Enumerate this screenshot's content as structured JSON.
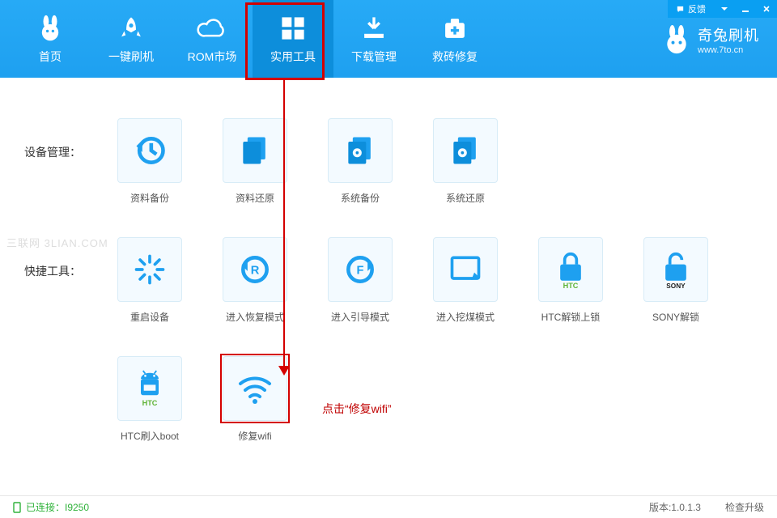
{
  "titlebar": {
    "feedback": "反馈"
  },
  "nav": {
    "items": [
      {
        "label": "首页"
      },
      {
        "label": "一键刷机"
      },
      {
        "label": "ROM市场"
      },
      {
        "label": "实用工具"
      },
      {
        "label": "下载管理"
      },
      {
        "label": "救砖修复"
      }
    ]
  },
  "brand": {
    "name": "奇兔刷机",
    "url": "www.7to.cn"
  },
  "sections": {
    "device": {
      "label": "设备管理：",
      "tools": [
        {
          "label": "资料备份"
        },
        {
          "label": "资料还原"
        },
        {
          "label": "系统备份"
        },
        {
          "label": "系统还原"
        }
      ]
    },
    "quick": {
      "label": "快捷工具：",
      "tools": [
        {
          "label": "重启设备"
        },
        {
          "label": "进入恢复模式"
        },
        {
          "label": "进入引导模式"
        },
        {
          "label": "进入挖煤模式"
        },
        {
          "label": "HTC解锁上锁",
          "badge": "HTC",
          "badge_color": "#5fb336"
        },
        {
          "label": "SONY解锁",
          "badge": "SONY",
          "badge_color": "#222"
        }
      ]
    },
    "extra": {
      "tools": [
        {
          "label": "HTC刷入boot",
          "badge": "HTC",
          "badge_color": "#5fb336"
        },
        {
          "label": "修复wifi"
        }
      ]
    }
  },
  "annotation": "点击“修复wifi”",
  "watermark": "三联网 3LIAN.COM",
  "status": {
    "connected": "已连接：I9250",
    "version": "版本:1.0.1.3",
    "update": "检查升级"
  }
}
